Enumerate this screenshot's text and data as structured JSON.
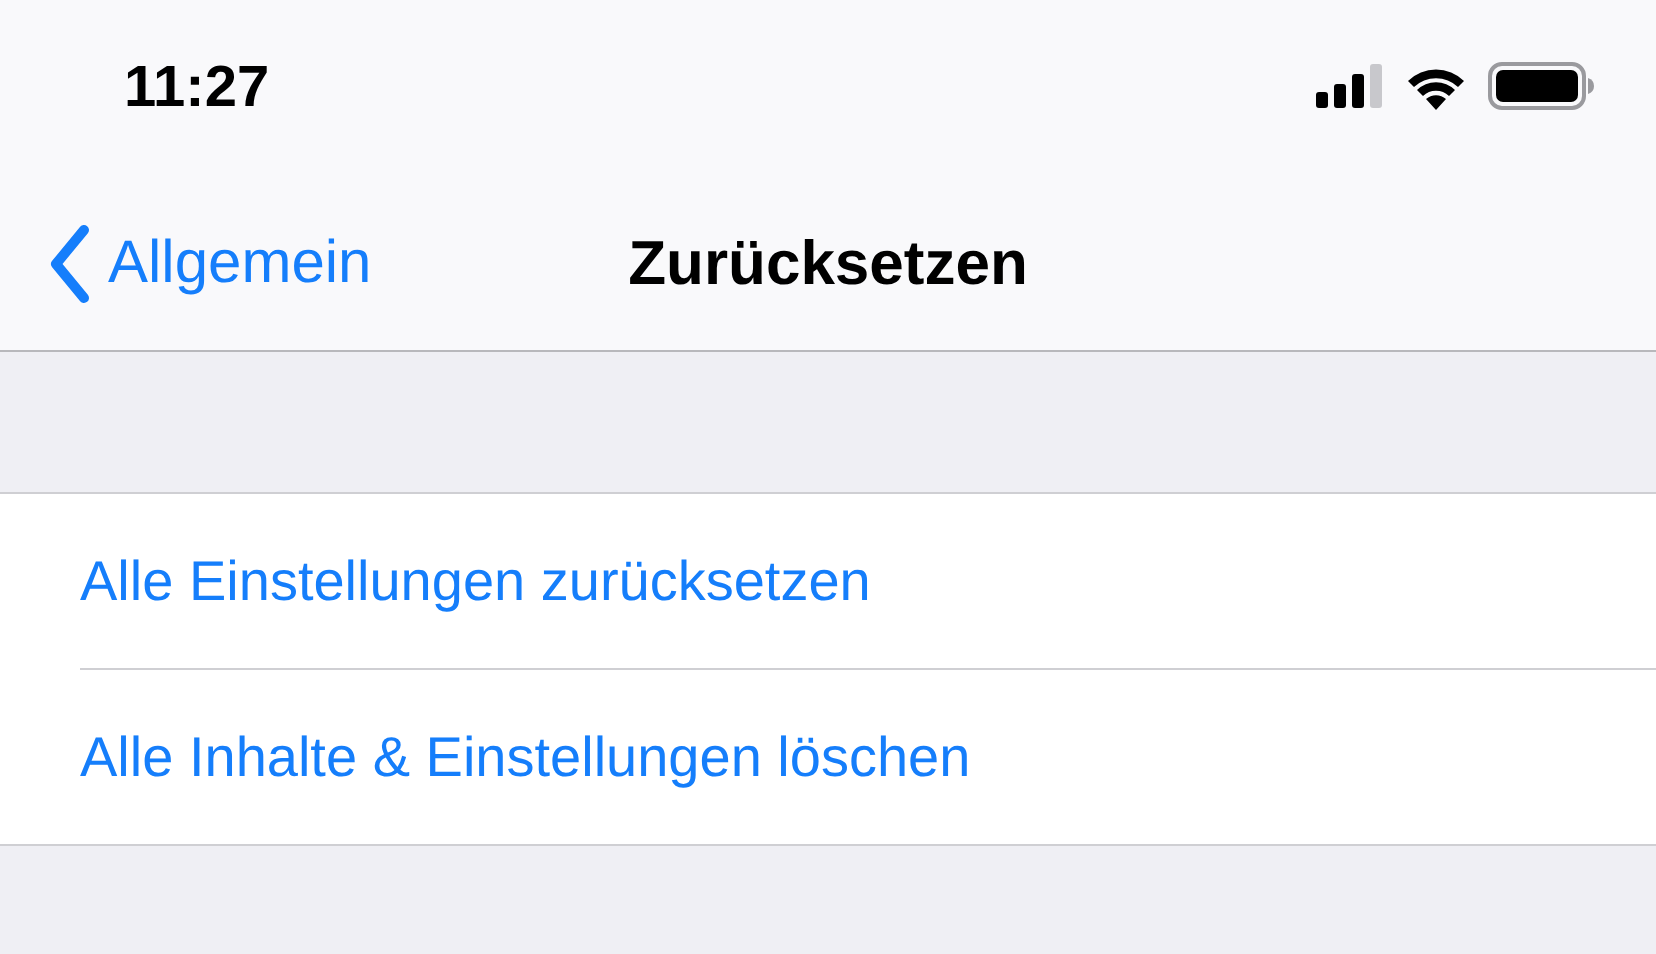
{
  "status_bar": {
    "time": "11:27"
  },
  "nav_bar": {
    "back_label": "Allgemein",
    "title": "Zurücksetzen"
  },
  "items": [
    {
      "label": "Alle Einstellungen zurücksetzen"
    },
    {
      "label": "Alle Inhalte & Einstellungen löschen"
    }
  ]
}
